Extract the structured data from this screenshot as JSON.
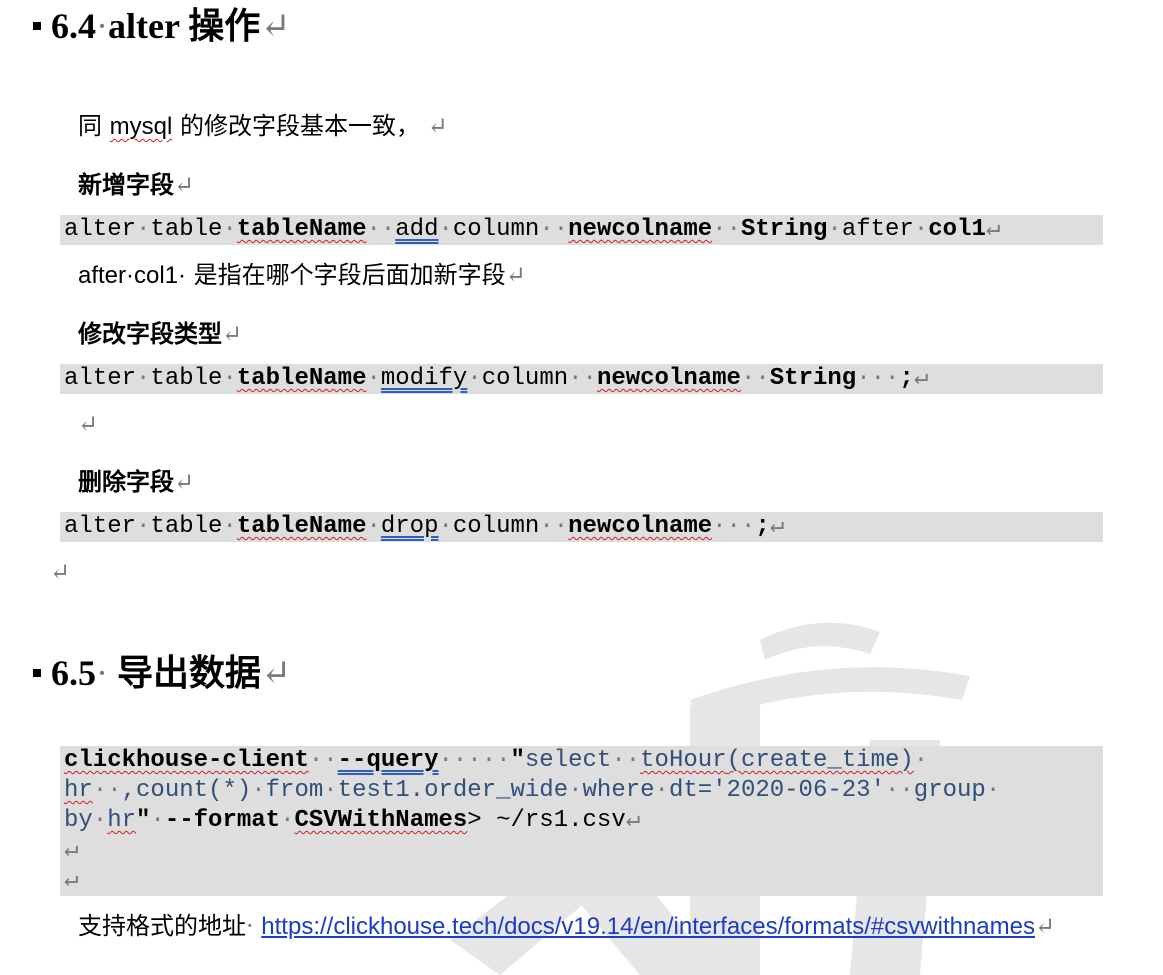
{
  "section64": {
    "number": "6.4",
    "title": "alter 操作",
    "intro": {
      "pre": "同 ",
      "word": "mysql",
      "post": " 的修改字段基本一致，"
    },
    "add_heading": "新增字段",
    "add_code": {
      "alter": "alter",
      "table": "table",
      "tableName": "tableName",
      "add": "add",
      "column": "column",
      "newcolname": "newcolname",
      "String": "String",
      "after": "after",
      "col1": "col1"
    },
    "after_note": {
      "code": "after·col1·",
      "text": " 是指在哪个字段后面加新字段"
    },
    "modify_heading": "修改字段类型",
    "modify_code": {
      "alter": "alter",
      "table": "table",
      "tableName": "tableName",
      "modify": "modify",
      "column": "column",
      "newcolname": "newcolname",
      "String": "String",
      "end": ";"
    },
    "drop_heading": "删除字段",
    "drop_code": {
      "alter": "alter",
      "table": "table",
      "tableName": "tableName",
      "drop": "drop",
      "column": "column",
      "newcolname": "newcolname",
      "end": ";"
    }
  },
  "section65": {
    "number": "6.5",
    "title": "导出数据",
    "export_code": {
      "client": "clickhouse-client",
      "query_flag": "--query",
      "q_open": "\"",
      "select": "select",
      "toHour": "toHour",
      "create_time": "(create_time)",
      "hr": "hr",
      "count": ",count(*)",
      "from": "from",
      "table": "test1.order_wide",
      "where": "where",
      "dt": "dt='2020-06-23'",
      "group": "group",
      "by": "by",
      "hr2": "hr",
      "q_close": "\"",
      "format_flag": "--format",
      "format": "CSVWithNames",
      "redirect": "> ~/rs1.csv"
    },
    "support_label": "支持格式的地址",
    "support_link": "https://clickhouse.tech/docs/v19.14/en/interfaces/formats/#csvwithnames"
  },
  "marks": {
    "para": "↵",
    "space": "·"
  }
}
